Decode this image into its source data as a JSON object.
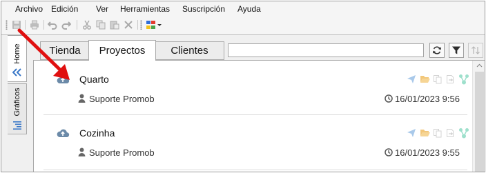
{
  "menu": {
    "items": [
      "Archivo",
      "Edición",
      "Ver",
      "Herramientas",
      "Suscripción",
      "Ayuda"
    ]
  },
  "toolbar": {
    "icons": [
      "save-icon",
      "print-icon",
      "undo-icon",
      "redo-icon",
      "cut-icon",
      "copy-icon",
      "paste-icon",
      "delete-icon",
      "color-palette-icon"
    ]
  },
  "left_tabs": {
    "home": "Home",
    "graficos": "Gráficos"
  },
  "tabs": {
    "tienda": "Tienda",
    "proyectos": "Proyectos",
    "clientes": "Clientes",
    "active": "proyectos"
  },
  "search": {
    "value": ""
  },
  "projects": [
    {
      "name": "Quarto",
      "user": "Suporte Promob",
      "date": "16/01/2023 9:56"
    },
    {
      "name": "Cozinha",
      "user": "Suporte Promob",
      "date": "16/01/2023 9:55"
    }
  ],
  "colors": {
    "accent_blue": "#3a78c8",
    "cloud_icon": "#6b8aa8",
    "faded_send": "#a9c9ea",
    "faded_folder": "#f2c77a",
    "faded_share": "#9ee0cc",
    "annotation_arrow": "#e01010"
  }
}
